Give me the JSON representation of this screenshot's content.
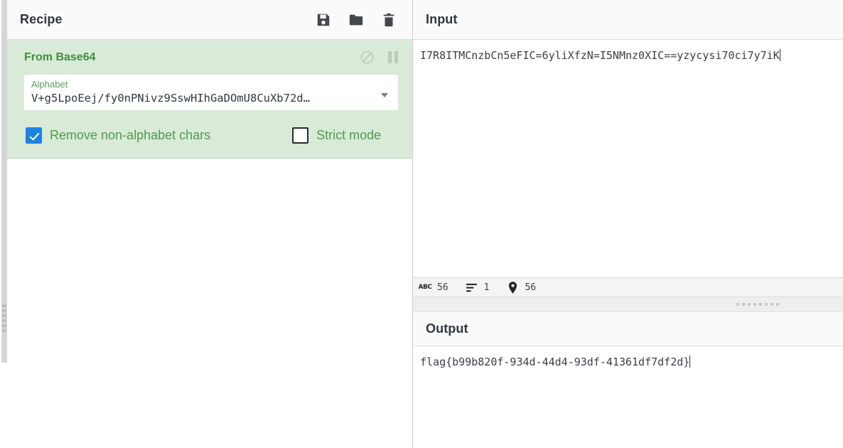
{
  "recipe": {
    "title": "Recipe",
    "toolbar": [
      {
        "name": "save-recipe-button",
        "icon": "save-icon"
      },
      {
        "name": "load-recipe-button",
        "icon": "folder-icon"
      },
      {
        "name": "clear-recipe-button",
        "icon": "trash-icon"
      }
    ],
    "operation": {
      "title": "From Base64",
      "controls": [
        {
          "name": "disable-operation-button",
          "icon": "disable-circle-slash-icon"
        },
        {
          "name": "breakpoint-button",
          "icon": "pause-icon"
        }
      ],
      "argument": {
        "label": "Alphabet",
        "value": "V+g5LpoEej/fy0nPNivz9SswHIhGaDOmU8CuXb72d…"
      },
      "checkboxes": [
        {
          "label": "Remove non-alphabet chars",
          "checked": true
        },
        {
          "label": "Strict mode",
          "checked": false
        }
      ]
    }
  },
  "input": {
    "title": "Input",
    "value": "I7R8ITMCnzbCn5eFIC=6yliXfzN=I5NMnz0XIC==yzycysi70ci7y7iK",
    "status": {
      "length_label": "ABC",
      "length": "56",
      "lines": "1",
      "position": "56"
    }
  },
  "output": {
    "title": "Output",
    "value": "flag{b99b820f-934d-44d4-93df-41361df7df2d}"
  },
  "colors": {
    "operation_bg": "#d9ead8",
    "operation_text": "#3f8f3c",
    "checkbox_checked": "#1d83e2",
    "header_bg": "#fafafa"
  }
}
